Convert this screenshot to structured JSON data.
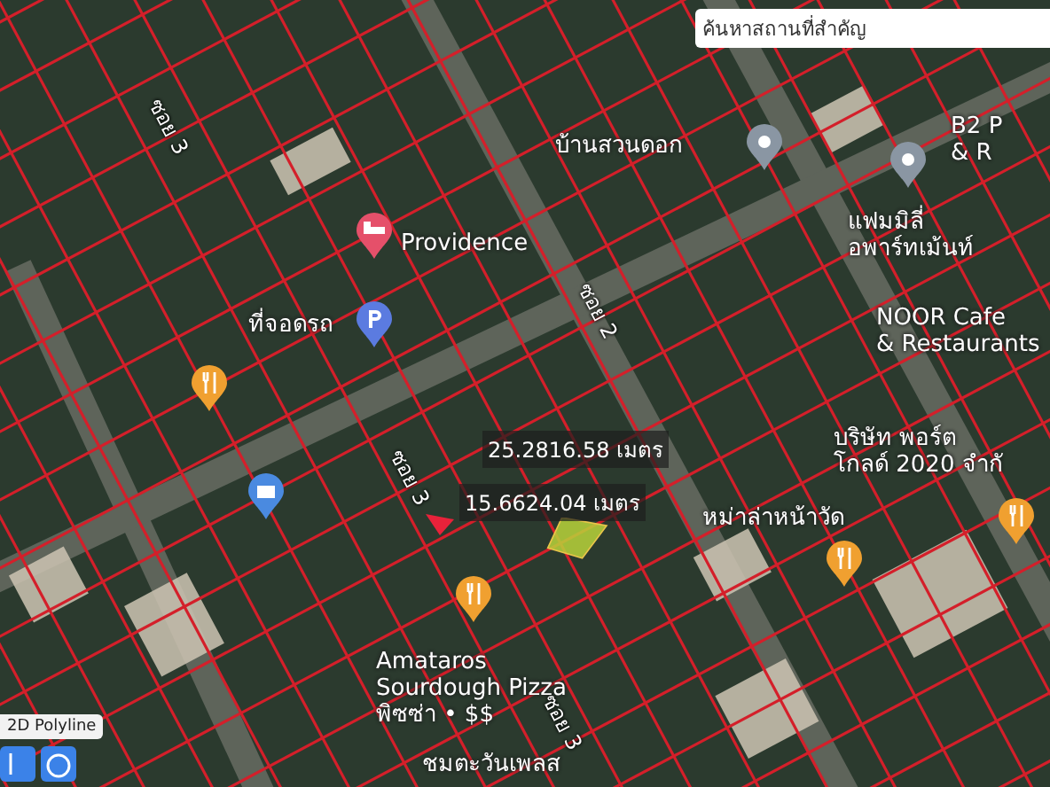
{
  "search": {
    "placeholder": "ค้นหาสถานที่สำคัญ"
  },
  "roads": [
    {
      "label": "ซอย 3"
    },
    {
      "label": "ซอย 2"
    },
    {
      "label": "ซอย 3"
    },
    {
      "label": "ซอย 3"
    }
  ],
  "places": [
    {
      "kind": "hotel",
      "lines": [
        "Providence"
      ]
    },
    {
      "kind": "parking",
      "lines": [
        "ที่จอดรถ"
      ]
    },
    {
      "kind": "pin",
      "lines": [
        "บ้านสวนดอก"
      ]
    },
    {
      "lines": [
        "B2 P",
        "& R"
      ]
    },
    {
      "kind": "pin",
      "lines": [
        "แฟมมิลี่",
        "อพาร์ทเม้นท์"
      ]
    },
    {
      "lines": [
        "NOOR Cafe",
        "& Restaurants"
      ]
    },
    {
      "lines": [
        "บริษัท พอร์ต",
        "โกลด์ 2020 จำกั"
      ]
    },
    {
      "kind": "restaurant",
      "lines": [
        "หม่าล่าหน้าวัด"
      ]
    },
    {
      "kind": "restaurant",
      "lines": [
        "Amataros",
        "Sourdough Pizza",
        "พิซซ่า • $$"
      ]
    },
    {
      "lines": [
        "ชมตะวันเพลส"
      ]
    }
  ],
  "markers": [
    {
      "kind": "restaurant"
    },
    {
      "kind": "shop"
    },
    {
      "kind": "restaurant"
    }
  ],
  "measurements": [
    {
      "text": "25.2816.58 เมตร"
    },
    {
      "text": "15.6624.04 เมตร"
    }
  ],
  "tool": {
    "label": "2D Polyline"
  }
}
